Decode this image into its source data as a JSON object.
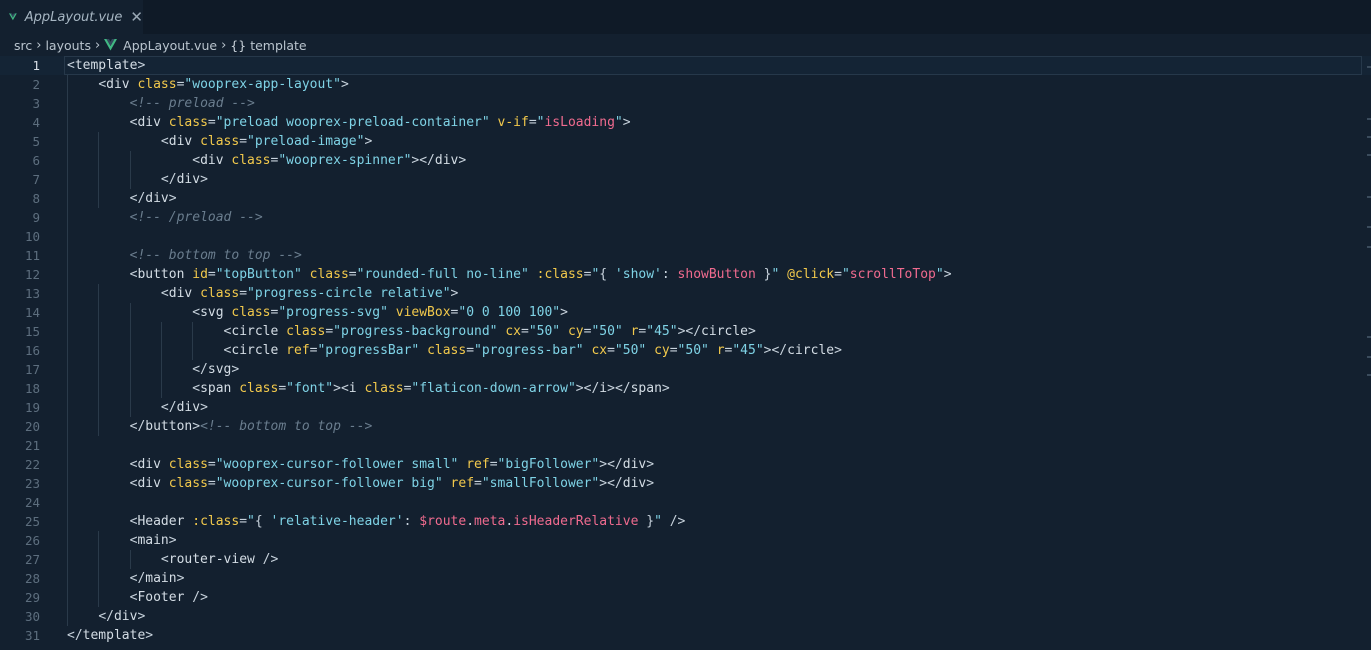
{
  "tab": {
    "filename": "AppLayout.vue",
    "close_glyph": "✕",
    "icon": "vue-icon"
  },
  "breadcrumb": {
    "parts": [
      "src",
      "layouts",
      "AppLayout.vue",
      "template"
    ],
    "braces": "{}"
  },
  "colors": {
    "background": "#13202f",
    "tag": "#d4dde5",
    "attribute": "#f2c94c",
    "string": "#7fd3e6",
    "comment": "#6a7d8e",
    "binding": "#f06b8f"
  },
  "editor": {
    "active_line": 1,
    "lines": [
      {
        "n": "1",
        "text": "<template>"
      },
      {
        "n": "2",
        "text": "    <div class=\"wooprex-app-layout\">"
      },
      {
        "n": "3",
        "text": "        <!-- preload -->"
      },
      {
        "n": "4",
        "text": "        <div class=\"preload wooprex-preload-container\" v-if=\"isLoading\">"
      },
      {
        "n": "5",
        "text": "            <div class=\"preload-image\">"
      },
      {
        "n": "6",
        "text": "                <div class=\"wooprex-spinner\"></div>"
      },
      {
        "n": "7",
        "text": "            </div>"
      },
      {
        "n": "8",
        "text": "        </div>"
      },
      {
        "n": "9",
        "text": "        <!-- /preload -->"
      },
      {
        "n": "10",
        "text": ""
      },
      {
        "n": "11",
        "text": "        <!-- bottom to top -->"
      },
      {
        "n": "12",
        "text": "        <button id=\"topButton\" class=\"rounded-full no-line\" :class=\"{ 'show': showButton }\" @click=\"scrollToTop\">"
      },
      {
        "n": "13",
        "text": "            <div class=\"progress-circle relative\">"
      },
      {
        "n": "14",
        "text": "                <svg class=\"progress-svg\" viewBox=\"0 0 100 100\">"
      },
      {
        "n": "15",
        "text": "                    <circle class=\"progress-background\" cx=\"50\" cy=\"50\" r=\"45\"></circle>"
      },
      {
        "n": "16",
        "text": "                    <circle ref=\"progressBar\" class=\"progress-bar\" cx=\"50\" cy=\"50\" r=\"45\"></circle>"
      },
      {
        "n": "17",
        "text": "                </svg>"
      },
      {
        "n": "18",
        "text": "                <span class=\"font\"><i class=\"flaticon-down-arrow\"></i></span>"
      },
      {
        "n": "19",
        "text": "            </div>"
      },
      {
        "n": "20",
        "text": "        </button><!-- bottom to top -->"
      },
      {
        "n": "21",
        "text": ""
      },
      {
        "n": "22",
        "text": "        <div class=\"wooprex-cursor-follower small\" ref=\"bigFollower\"></div>"
      },
      {
        "n": "23",
        "text": "        <div class=\"wooprex-cursor-follower big\" ref=\"smallFollower\"></div>"
      },
      {
        "n": "24",
        "text": ""
      },
      {
        "n": "25",
        "text": "        <Header :class=\"{ 'relative-header': $route.meta.isHeaderRelative }\" />"
      },
      {
        "n": "26",
        "text": "        <main>"
      },
      {
        "n": "27",
        "text": "            <router-view />"
      },
      {
        "n": "28",
        "text": "        </main>"
      },
      {
        "n": "29",
        "text": "        <Footer />"
      },
      {
        "n": "30",
        "text": "    </div>"
      },
      {
        "n": "31",
        "text": "</template>"
      }
    ]
  }
}
